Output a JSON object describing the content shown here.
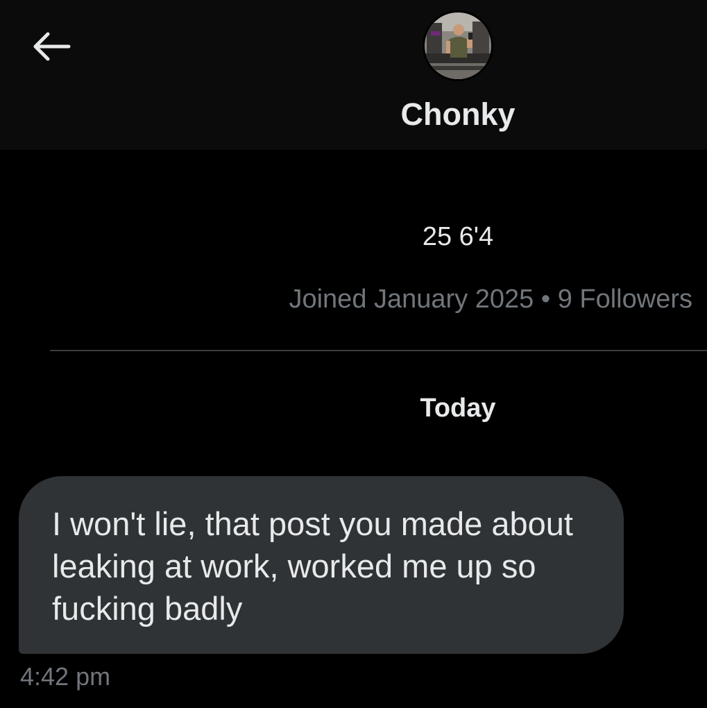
{
  "header": {
    "contact_name": "Chonky",
    "back_icon": "arrow-left-icon",
    "avatar_icon": "profile-photo"
  },
  "profile": {
    "bio": "25 6'4",
    "meta": "Joined January 2025 • 9 Followers"
  },
  "conversation": {
    "date_separator": "Today",
    "messages": [
      {
        "text": "I won't lie, that post you made about leaking at work, worked me up so fucking badly",
        "time": "4:42 pm"
      }
    ]
  },
  "colors": {
    "background": "#000000",
    "header_background": "#0b0b0b",
    "bubble": "#2f3336",
    "primary_text": "#e7e9ea",
    "secondary_text": "#71767b"
  }
}
